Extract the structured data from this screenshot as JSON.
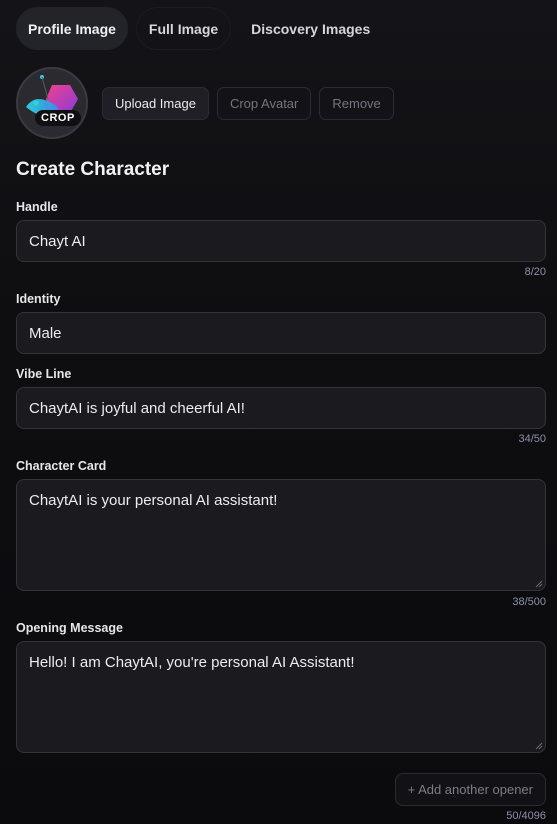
{
  "tabs": [
    {
      "label": "Profile Image",
      "active": true
    },
    {
      "label": "Full Image",
      "active": false
    },
    {
      "label": "Discovery Images",
      "active": false
    }
  ],
  "avatar": {
    "badge": "CROP"
  },
  "avatar_actions": {
    "upload": "Upload Image",
    "crop": "Crop Avatar",
    "remove": "Remove"
  },
  "form": {
    "title": "Create Character",
    "handle": {
      "label": "Handle",
      "value": "Chayt AI",
      "counter": "8/20"
    },
    "identity": {
      "label": "Identity",
      "value": "Male"
    },
    "vibe_line": {
      "label": "Vibe Line",
      "value": "ChaytAI is joyful and cheerful AI!",
      "counter": "34/50"
    },
    "character_card": {
      "label": "Character Card",
      "value": "ChaytAI is your personal AI assistant!",
      "counter": "38/500"
    },
    "opening_message": {
      "label": "Opening Message",
      "value": "Hello! I am ChaytAI, you're personal AI Assistant!",
      "counter": "50/4096"
    },
    "add_opener": "+ Add another opener"
  },
  "colors": {
    "background": "#0d0d10",
    "field_bg": "#1a1a1f",
    "field_border": "#33333b",
    "counter": "#8b8fa8",
    "logo_pink": "#e23a8f",
    "logo_cyan": "#2fd3d9"
  }
}
